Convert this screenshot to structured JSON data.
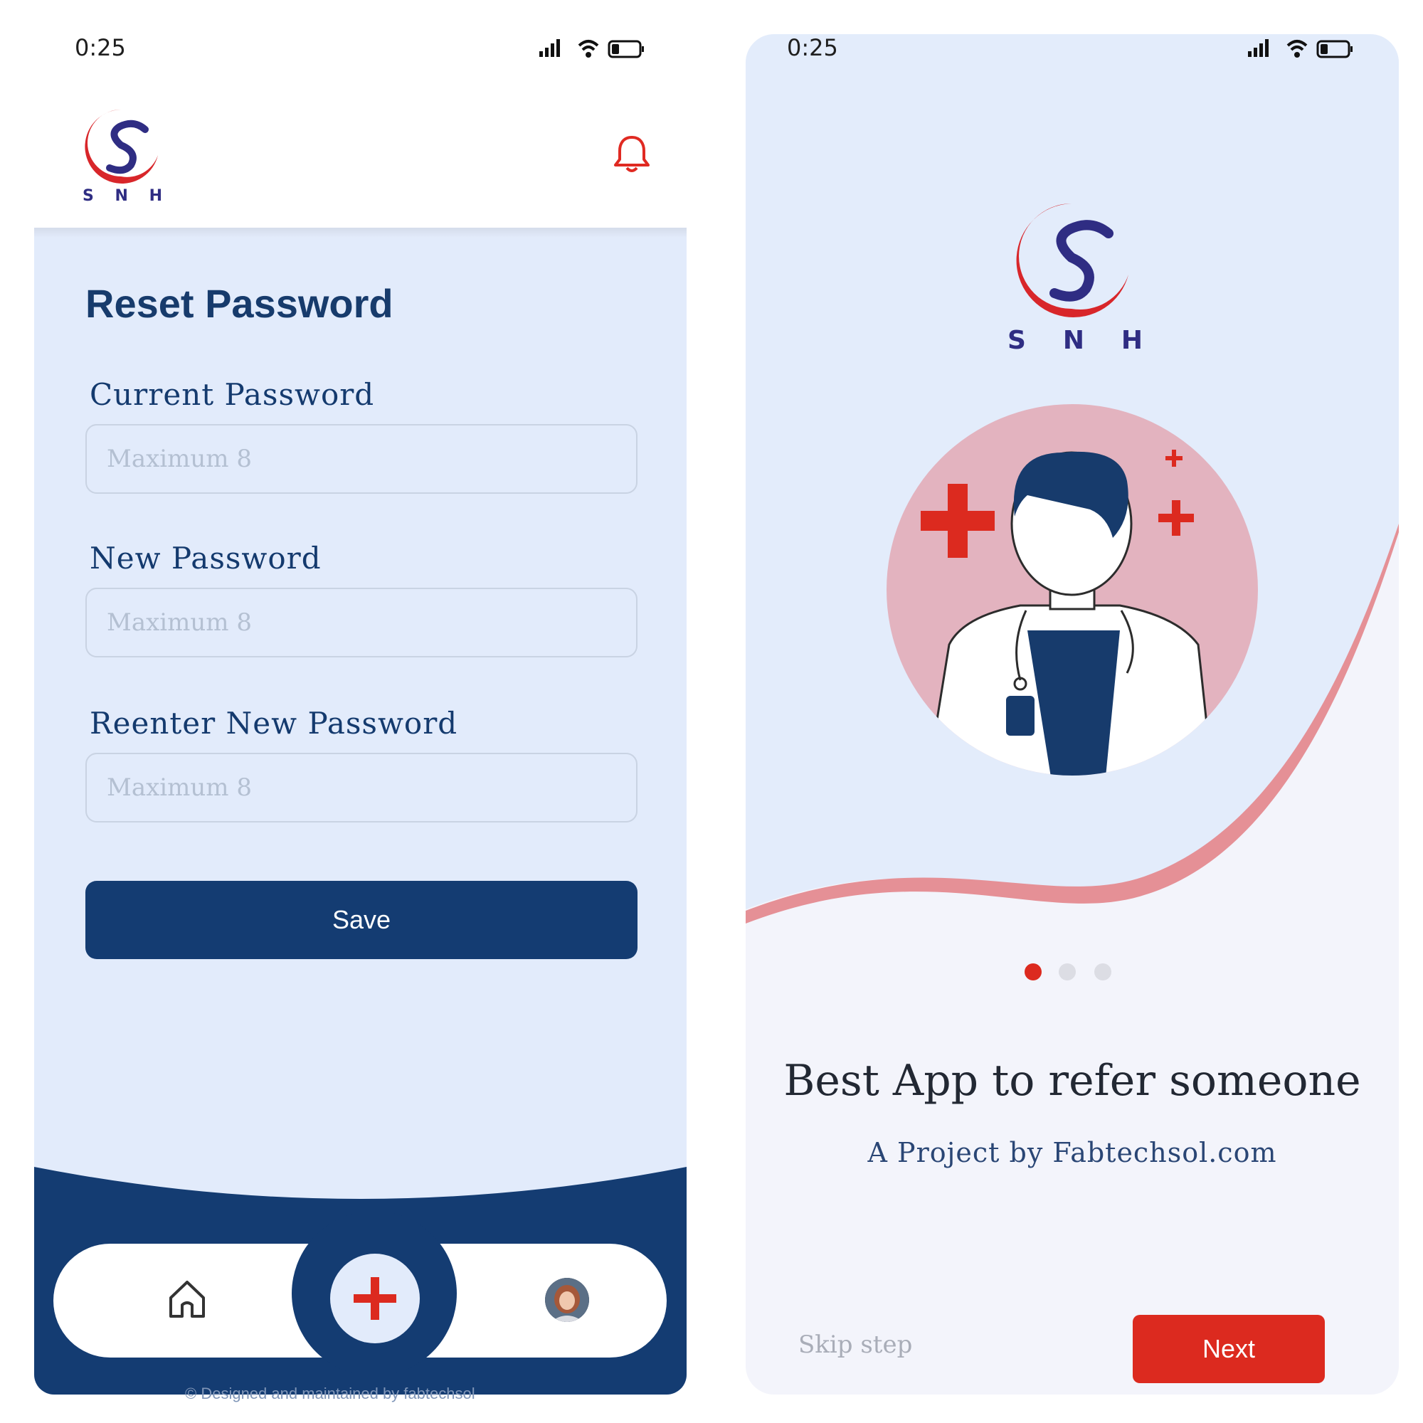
{
  "left": {
    "status": {
      "time": "0:25"
    },
    "brand": {
      "logo_text": "SNH"
    },
    "title": "Reset Password",
    "fields": [
      {
        "label": "Current Password",
        "placeholder": "Maximum 8"
      },
      {
        "label": "New Password",
        "placeholder": "Maximum 8"
      },
      {
        "label": "Reenter New Password",
        "placeholder": "Maximum 8"
      }
    ],
    "save_label": "Save",
    "footer": "© Designed and maintained by fabtechsol"
  },
  "right": {
    "status": {
      "time": "0:25"
    },
    "brand": {
      "logo_text": "SNH"
    },
    "headline": "Best App to refer someone",
    "subtitle": "A Project by Fabtechsol.com",
    "skip_label": "Skip step",
    "next_label": "Next",
    "pager": {
      "count": 3,
      "active": 0
    }
  },
  "colors": {
    "navy": "#143c72",
    "accent_red": "#dc2a1f",
    "panel_blue": "#e2ebfb",
    "pink_circle": "#e3b3bf"
  }
}
